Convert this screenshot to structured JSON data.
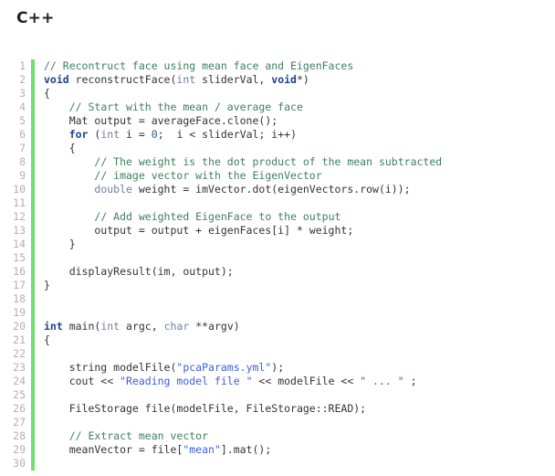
{
  "header": {
    "language_label": "C++"
  },
  "editor": {
    "gutter_color": "#b0b0b0",
    "separator_color": "#6ee06e",
    "background_color": "#ffffff",
    "comment_color": "#3f7f5f",
    "keyword_color": "#1f3f8f",
    "type_color": "#7080a0",
    "string_color": "#3b5fe0",
    "number_color": "#206080",
    "text_color": "#333333",
    "first_line_number": 1,
    "last_line_number": 30,
    "lines": [
      {
        "n": "1",
        "tokens": [
          {
            "t": "// Recontruct face using mean face and EigenFaces",
            "c": "tok-com"
          }
        ]
      },
      {
        "n": "2",
        "tokens": [
          {
            "t": "void",
            "c": "tok-kw"
          },
          {
            "t": " reconstructFace(",
            "c": "tok-plain"
          },
          {
            "t": "int",
            "c": "tok-type"
          },
          {
            "t": " sliderVal, ",
            "c": "tok-plain"
          },
          {
            "t": "void",
            "c": "tok-kw"
          },
          {
            "t": "*)",
            "c": "tok-plain"
          }
        ]
      },
      {
        "n": "3",
        "tokens": [
          {
            "t": "{",
            "c": "tok-plain"
          }
        ]
      },
      {
        "n": "4",
        "tokens": [
          {
            "t": "    ",
            "c": "tok-plain"
          },
          {
            "t": "// Start with the mean / average face",
            "c": "tok-com"
          }
        ]
      },
      {
        "n": "5",
        "tokens": [
          {
            "t": "    Mat output = averageFace.clone();",
            "c": "tok-plain"
          }
        ]
      },
      {
        "n": "6",
        "tokens": [
          {
            "t": "    ",
            "c": "tok-plain"
          },
          {
            "t": "for",
            "c": "tok-kw"
          },
          {
            "t": " (",
            "c": "tok-plain"
          },
          {
            "t": "int",
            "c": "tok-type"
          },
          {
            "t": " i = ",
            "c": "tok-plain"
          },
          {
            "t": "0",
            "c": "tok-num"
          },
          {
            "t": ";  i < sliderVal; i++)",
            "c": "tok-plain"
          }
        ]
      },
      {
        "n": "7",
        "tokens": [
          {
            "t": "    {",
            "c": "tok-plain"
          }
        ]
      },
      {
        "n": "8",
        "tokens": [
          {
            "t": "        ",
            "c": "tok-plain"
          },
          {
            "t": "// The weight is the dot product of the mean subtracted",
            "c": "tok-com"
          }
        ]
      },
      {
        "n": "9",
        "tokens": [
          {
            "t": "        ",
            "c": "tok-plain"
          },
          {
            "t": "// image vector with the EigenVector",
            "c": "tok-com"
          }
        ]
      },
      {
        "n": "10",
        "tokens": [
          {
            "t": "        ",
            "c": "tok-plain"
          },
          {
            "t": "double",
            "c": "tok-type"
          },
          {
            "t": " weight = imVector.dot(eigenVectors.row(i));",
            "c": "tok-plain"
          }
        ]
      },
      {
        "n": "11",
        "tokens": [
          {
            "t": "",
            "c": "tok-plain"
          }
        ]
      },
      {
        "n": "12",
        "tokens": [
          {
            "t": "        ",
            "c": "tok-plain"
          },
          {
            "t": "// Add weighted EigenFace to the output",
            "c": "tok-com"
          }
        ]
      },
      {
        "n": "13",
        "tokens": [
          {
            "t": "        output = output + eigenFaces[i] * weight;",
            "c": "tok-plain"
          }
        ]
      },
      {
        "n": "14",
        "tokens": [
          {
            "t": "    }",
            "c": "tok-plain"
          }
        ]
      },
      {
        "n": "15",
        "tokens": [
          {
            "t": "",
            "c": "tok-plain"
          }
        ]
      },
      {
        "n": "16",
        "tokens": [
          {
            "t": "    displayResult(im, output);",
            "c": "tok-plain"
          }
        ]
      },
      {
        "n": "17",
        "tokens": [
          {
            "t": "}",
            "c": "tok-plain"
          }
        ]
      },
      {
        "n": "18",
        "tokens": [
          {
            "t": "",
            "c": "tok-plain"
          }
        ]
      },
      {
        "n": "19",
        "tokens": [
          {
            "t": "",
            "c": "tok-plain"
          }
        ]
      },
      {
        "n": "20",
        "tokens": [
          {
            "t": "int",
            "c": "tok-kw"
          },
          {
            "t": " main(",
            "c": "tok-plain"
          },
          {
            "t": "int",
            "c": "tok-type"
          },
          {
            "t": " argc, ",
            "c": "tok-plain"
          },
          {
            "t": "char",
            "c": "tok-type"
          },
          {
            "t": " **argv)",
            "c": "tok-plain"
          }
        ]
      },
      {
        "n": "21",
        "tokens": [
          {
            "t": "{",
            "c": "tok-plain"
          }
        ]
      },
      {
        "n": "22",
        "tokens": [
          {
            "t": "",
            "c": "tok-plain"
          }
        ]
      },
      {
        "n": "23",
        "tokens": [
          {
            "t": "    string modelFile(",
            "c": "tok-plain"
          },
          {
            "t": "\"pcaParams.yml\"",
            "c": "tok-str"
          },
          {
            "t": ");",
            "c": "tok-plain"
          }
        ]
      },
      {
        "n": "24",
        "tokens": [
          {
            "t": "    cout << ",
            "c": "tok-plain"
          },
          {
            "t": "\"Reading model file \"",
            "c": "tok-str"
          },
          {
            "t": " << modelFile << ",
            "c": "tok-plain"
          },
          {
            "t": "\" ... \"",
            "c": "tok-str"
          },
          {
            "t": " ;",
            "c": "tok-plain"
          }
        ]
      },
      {
        "n": "25",
        "tokens": [
          {
            "t": "",
            "c": "tok-plain"
          }
        ]
      },
      {
        "n": "26",
        "tokens": [
          {
            "t": "    FileStorage file(modelFile, FileStorage::READ);",
            "c": "tok-plain"
          }
        ]
      },
      {
        "n": "27",
        "tokens": [
          {
            "t": "",
            "c": "tok-plain"
          }
        ]
      },
      {
        "n": "28",
        "tokens": [
          {
            "t": "    ",
            "c": "tok-plain"
          },
          {
            "t": "// Extract mean vector",
            "c": "tok-com"
          }
        ]
      },
      {
        "n": "29",
        "tokens": [
          {
            "t": "    meanVector = file[",
            "c": "tok-plain"
          },
          {
            "t": "\"mean\"",
            "c": "tok-str"
          },
          {
            "t": "].mat();",
            "c": "tok-plain"
          }
        ]
      },
      {
        "n": "30",
        "tokens": [
          {
            "t": "",
            "c": "tok-plain"
          }
        ]
      }
    ]
  }
}
